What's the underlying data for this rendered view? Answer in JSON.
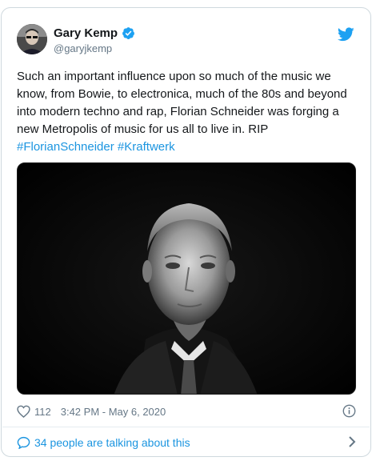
{
  "author": {
    "display_name": "Gary Kemp",
    "handle": "@garyjkemp",
    "verified": true
  },
  "tweet": {
    "text": "Such an important influence upon so much of the music we know, from Bowie, to electronica, much of the 80s and beyond into modern techno and rap, Florian Schneider was forging a new Metropolis of music for us all to live in. RIP",
    "hashtags": [
      "#FlorianSchneider",
      "#Kraftwerk"
    ]
  },
  "stats": {
    "likes": "112",
    "timestamp": "3:42 PM - May 6, 2020"
  },
  "conversation": {
    "label": "34 people are talking about this"
  },
  "icons": {
    "brand": "twitter-bird-icon",
    "verified": "verified-badge-icon",
    "like": "heart-icon",
    "info": "info-icon",
    "reply": "speech-bubble-icon",
    "more": "chevron-right-icon"
  },
  "colors": {
    "accent": "#1b95e0",
    "verified": "#1da1f2",
    "text": "#14171a",
    "muted": "#657786",
    "border": "#cfd9de"
  }
}
